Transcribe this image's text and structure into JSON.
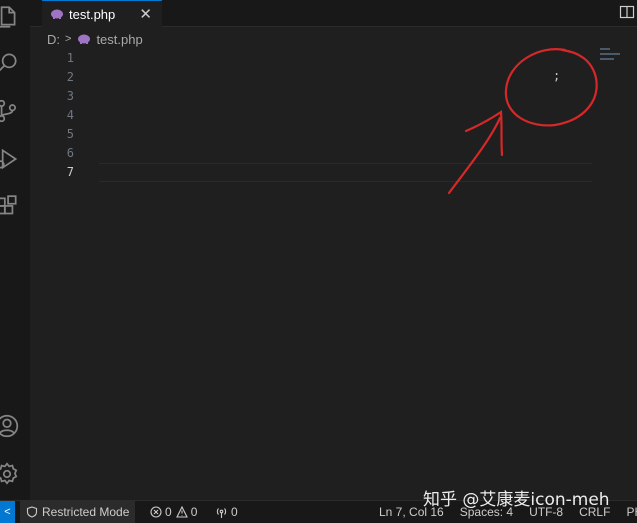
{
  "tab": {
    "label": "test.php",
    "close": "✕"
  },
  "breadcrumb": {
    "drive": "D:",
    "file": "test.php"
  },
  "editor": {
    "line_numbers": [
      "1",
      "2",
      "3",
      "4",
      "5",
      "6",
      "7"
    ],
    "active_line": "7",
    "code_char": ";"
  },
  "annotation": {
    "color": "#d62828"
  },
  "status_bar": {
    "restricted_mode": "Restricted Mode",
    "errors": "0",
    "warnings": "0",
    "ports": "0",
    "cursor_position": "Ln 7, Col 16",
    "spaces": "Spaces: 4",
    "encoding": "UTF-8",
    "eol": "CRLF",
    "language": "PHP"
  },
  "watermark": "知乎 @艾康麦icon-meh",
  "colors": {
    "accent": "#0078d4",
    "php_icon": "#a074c4",
    "editor_bg": "#1f1f1f"
  }
}
